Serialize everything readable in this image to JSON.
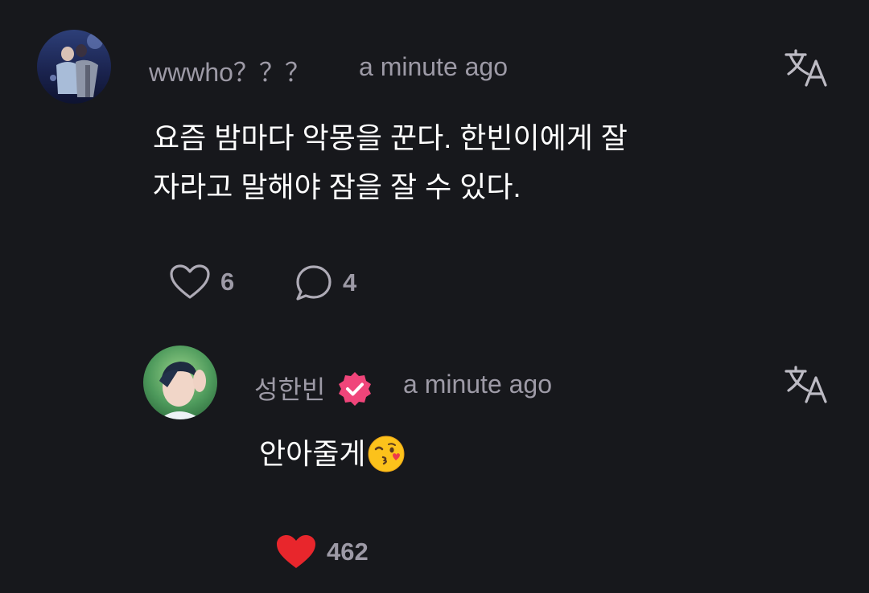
{
  "comment": {
    "username": "wwwho？？？",
    "time": "a minute ago",
    "text_line1": "요즘 밤마다 악몽을 꾼다. 한빈이에게 잘",
    "text_line2": "자라고 말해야 잠을 잘 수 있다.",
    "like_count": "6",
    "reply_count": "4"
  },
  "reply": {
    "username": "성한빈",
    "time": "a minute ago",
    "text": "안아줄게",
    "like_count": "462"
  },
  "colors": {
    "background": "#17181c",
    "muted_text": "#9d9aa6",
    "verified_badge": "#f0457a",
    "liked_heart": "#e8262c"
  },
  "icons": {
    "translate": "translate-icon",
    "like": "heart-outline-icon",
    "comment": "speech-bubble-icon",
    "verified": "verified-badge-icon",
    "liked": "heart-filled-icon",
    "emoji": "face-blowing-kiss-emoji"
  }
}
